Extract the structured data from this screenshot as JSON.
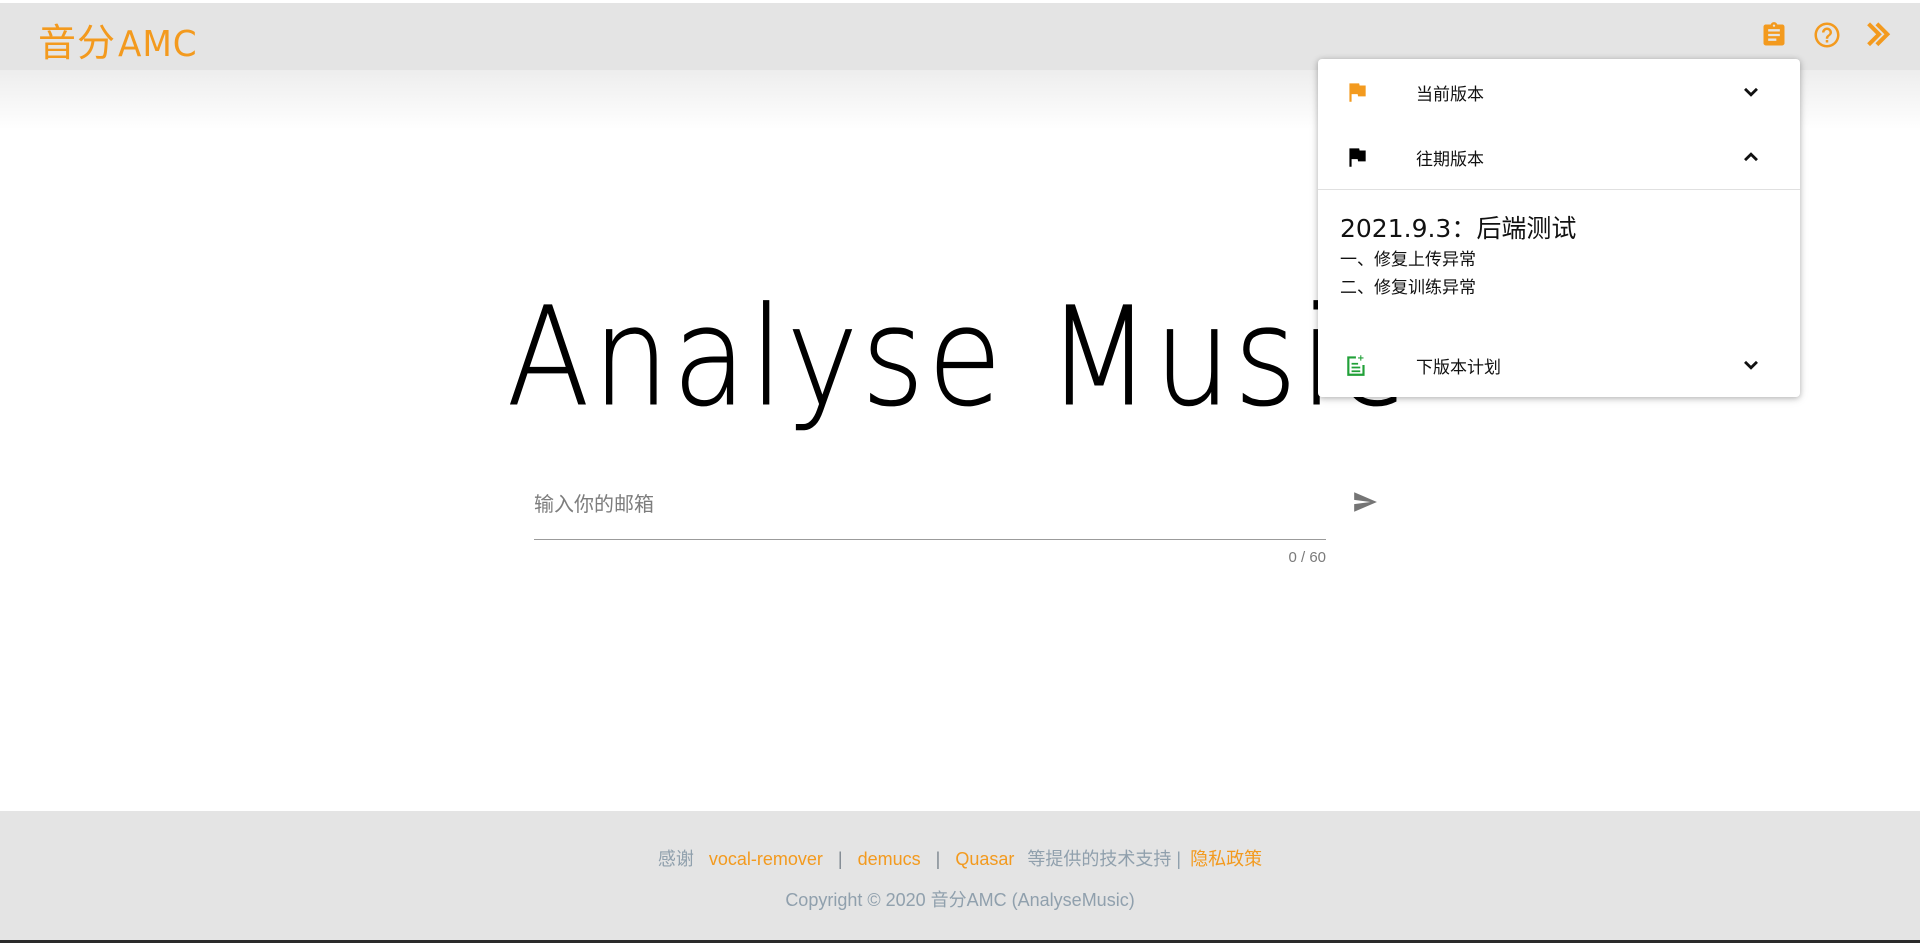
{
  "header": {
    "logo_cn": "音分",
    "logo_en": "AMC",
    "icons": [
      "clipboard-icon",
      "help-circle-icon",
      "double-chevron-right-icon"
    ]
  },
  "hero": {
    "title": "Analyse Music"
  },
  "email": {
    "placeholder": "输入你的邮箱",
    "value": "",
    "counter": "0 / 60"
  },
  "versions_panel": {
    "current": {
      "label": "当前版本",
      "icon": "orange-flag-icon"
    },
    "past": {
      "label": "往期版本",
      "icon": "black-flag-icon"
    },
    "past_content": {
      "title": "2021.9.3：后端测试",
      "lines": [
        "一、修复上传异常",
        "二、修复训练异常"
      ]
    },
    "next": {
      "label": "下版本计划",
      "icon": "note-add-icon"
    }
  },
  "footer": {
    "thanks": "感谢",
    "links": [
      "vocal-remover",
      "demucs",
      "Quasar"
    ],
    "support_text": "等提供的技术支持 |",
    "privacy": "隐私政策",
    "copyright": "Copyright © 2020 音分AMC (AnalyseMusic)"
  },
  "colors": {
    "accent": "#f39a1e",
    "header_bg": "#e4e4e4",
    "footer_text": "#90a0ad",
    "note_green": "#21a038"
  }
}
